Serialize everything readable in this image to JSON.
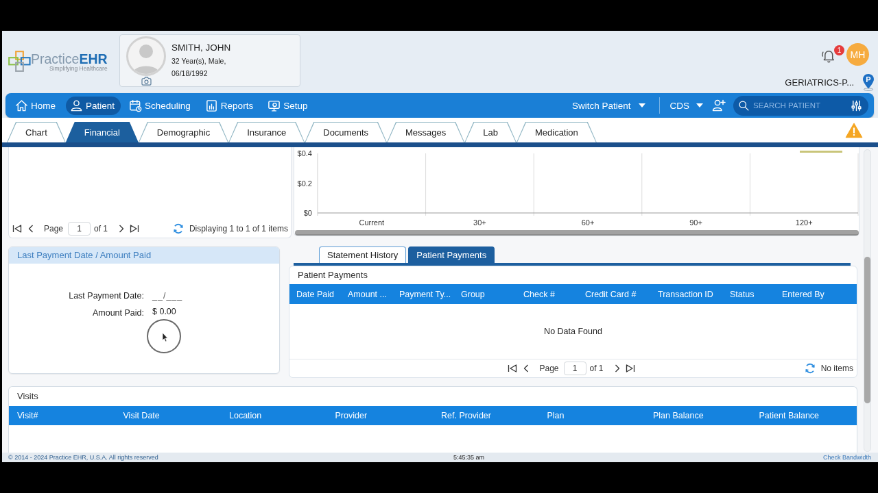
{
  "header": {
    "logo": {
      "wordmark": "Practice**EHR**",
      "tagline": "Simplifying Healthcare"
    },
    "patient": {
      "name": "SMITH, JOHN",
      "summary": "32 Year(s), Male,",
      "dob": "06/18/1992"
    },
    "notification_count": "1",
    "user_initials": "MH",
    "practice": "GERIATRICS-P...",
    "location": "P"
  },
  "nav": {
    "items": [
      {
        "kind": "home",
        "label": "Home",
        "selected": false
      },
      {
        "kind": "patient",
        "label": "Patient",
        "selected": true
      },
      {
        "kind": "scheduling",
        "label": "Scheduling",
        "selected": false
      },
      {
        "kind": "reports",
        "label": "Reports",
        "selected": false
      },
      {
        "kind": "setup",
        "label": "Setup",
        "selected": false
      }
    ],
    "switch_patient": "Switch Patient",
    "cds": "CDS",
    "search": {
      "placeholder": "SEARCH PATIENT"
    }
  },
  "tabs": [
    {
      "label": "Chart",
      "selected": false
    },
    {
      "label": "Financial",
      "selected": true
    },
    {
      "label": "Demographic",
      "selected": false
    },
    {
      "label": "Insurance",
      "selected": false
    },
    {
      "label": "Documents",
      "selected": false
    },
    {
      "label": "Messages",
      "selected": false
    },
    {
      "label": "Lab",
      "selected": false
    },
    {
      "label": "Medication",
      "selected": false
    }
  ],
  "list_panel": {
    "pager": {
      "page_label": "Page",
      "page": "1",
      "of": "of 1",
      "summary": "Displaying 1 to 1 of 1 items"
    }
  },
  "chart_panel": {
    "chart_data": {
      "type": "bar",
      "categories": [
        "Current",
        "30+",
        "60+",
        "90+",
        "120+"
      ],
      "series": [
        {
          "color": "#c9c57a",
          "values": [
            0,
            0,
            0,
            0,
            0
          ]
        }
      ],
      "ylim": [
        0,
        0.4
      ],
      "yticks": [
        {
          "value": 0,
          "label": "$0"
        },
        {
          "value": 0.2,
          "label": "$0.2"
        },
        {
          "value": 0.4,
          "label": "$0.4"
        }
      ]
    }
  },
  "last_payment": {
    "title": "Last Payment Date / Amount Paid",
    "fields": [
      {
        "label": "Last Payment Date:",
        "value": "__/___"
      },
      {
        "label": "Amount Paid:",
        "value": "$ 0.00"
      }
    ]
  },
  "payments": {
    "tabs": [
      {
        "label": "Statement History",
        "selected": false
      },
      {
        "label": "Patient Payments",
        "selected": true
      }
    ],
    "title": "Patient Payments",
    "columns": [
      "Date Paid",
      "Amount ...",
      "Payment Ty...",
      "Group",
      "Check #",
      "Credit Card #",
      "Transaction ID",
      "Status",
      "Entered By"
    ],
    "empty_message": "No Data Found",
    "pager": {
      "page_label": "Page",
      "page": "1",
      "of": "of 1",
      "summary": "No items"
    }
  },
  "visits": {
    "title": "Visits",
    "columns": [
      "Visit#",
      "Visit Date",
      "Location",
      "Provider",
      "Ref. Provider",
      "Plan",
      "Plan Balance",
      "Patient Balance"
    ]
  },
  "status_bar": {
    "copyright": "© 2014 - 2024 Practice EHR, U.S.A. All rights reserved",
    "time": "5:45:35 am",
    "link": "Check Bandwidth"
  }
}
